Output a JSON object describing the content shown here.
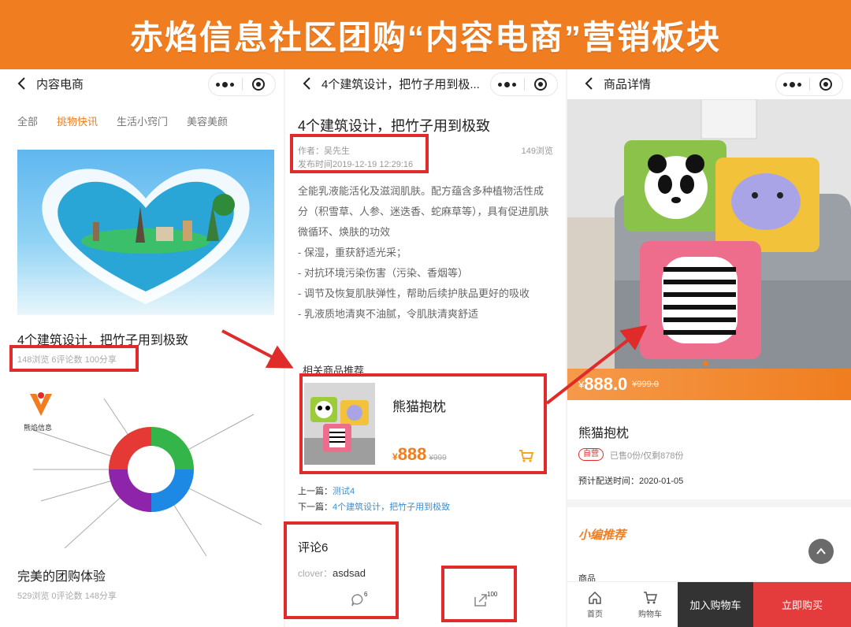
{
  "banner": {
    "title": "赤焰信息社区团购“内容电商”营销板块"
  },
  "colors": {
    "brand": "#f07d1f",
    "highlight": "#e02b2b",
    "link": "#3a8ed0",
    "buy": "#e43c3c"
  },
  "screen1": {
    "nav_title": "内容电商",
    "tabs": [
      "全部",
      "挑物快讯",
      "生活小窍门",
      "美容美颜"
    ],
    "active_tab_index": 1,
    "articles": [
      {
        "title": "4个建筑设计，把竹子用到极致",
        "meta": "148浏览 6评论数 100分享"
      },
      {
        "title": "完美的团购体验",
        "meta": "529浏览 0评论数 148分享"
      }
    ],
    "logo_text": "熊焰信息"
  },
  "screen2": {
    "nav_title": "4个建筑设计，把竹子用到极...",
    "title": "4个建筑设计，把竹子用到极致",
    "author": "作者：吴先生",
    "published": "发布时间2019-12-19 12:29:16",
    "views": "149浏览",
    "body_lines": [
      "全能乳液能活化及滋润肌肤。配方蕴含多种植物活性成",
      "分（积雪草、人参、迷迭香、蛇麻草等），具有促进肌肤",
      "微循环、焕肤的功效",
      "- 保湿，重获舒适光采；",
      "- 对抗环境污染伤害（污染、香烟等）",
      "- 调节及恢复肌肤弹性，帮助后续护肤品更好的吸收",
      "- 乳液质地清爽不油腻，令肌肤清爽舒适"
    ],
    "related_label": "相关商品推荐",
    "product": {
      "name": "熊猫抱枕",
      "currency": "¥",
      "price": "888",
      "old_price": "¥999"
    },
    "prev_label": "上一篇：",
    "prev_link": "测试4",
    "next_label": "下一篇：",
    "next_link": "4个建筑设计，把竹子用到极致",
    "comments_title": "评论6",
    "comment_user": "clover：",
    "comment_text": "asdsad",
    "comment_count": "6",
    "share_count": "100"
  },
  "screen3": {
    "nav_title": "商品详情",
    "price_currency": "¥",
    "price": "888.0",
    "old_price": "¥999.0",
    "name": "熊猫抱枕",
    "badge": "自营",
    "sold": "已售0份/仅剩878份",
    "delivery": "预计配送时间：2020-01-05",
    "recommend": "小编推荐",
    "goods_label": "商品",
    "bottom_bar": {
      "home": "首页",
      "cart": "购物车",
      "add_to_cart": "加入购物车",
      "buy_now": "立即购买"
    }
  }
}
